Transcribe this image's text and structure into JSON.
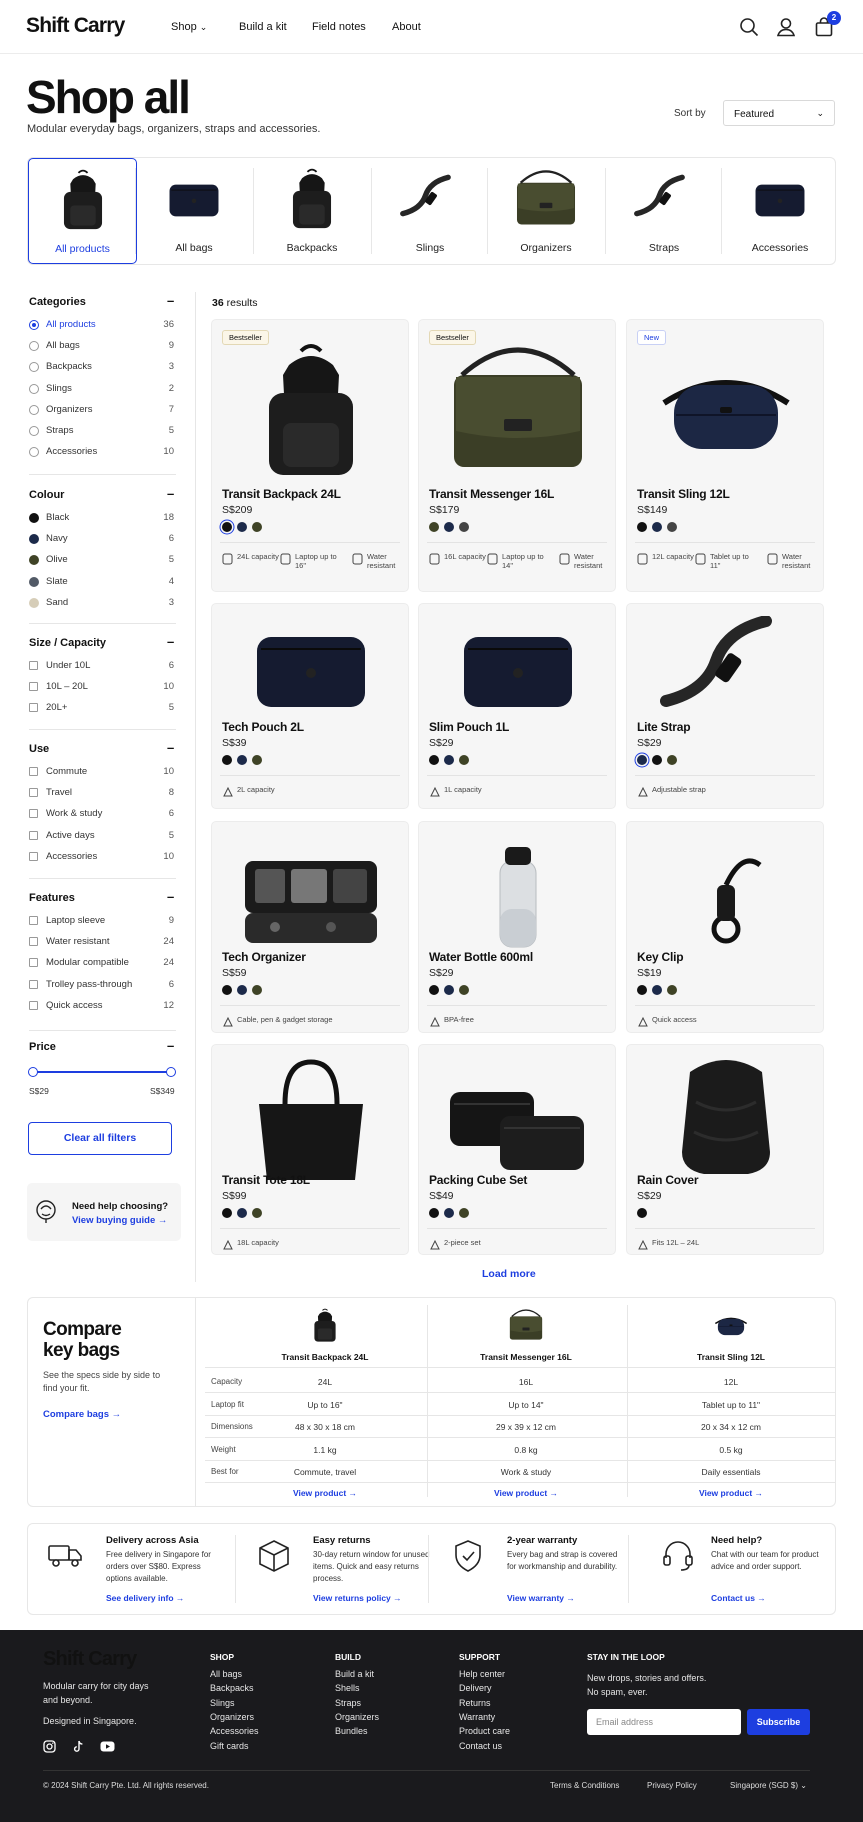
{
  "header": {
    "logo": "Shift Carry",
    "nav": [
      "Shop",
      "Build a kit",
      "Field notes",
      "About"
    ],
    "cart_count": "2"
  },
  "page": {
    "title": "Shop all",
    "subtitle": "Modular everyday bags, organizers, straps and accessories.",
    "sort_label": "Sort by",
    "sort_value": "Featured"
  },
  "categories_strip": [
    "All products",
    "All bags",
    "Backpacks",
    "Slings",
    "Organizers",
    "Straps",
    "Accessories"
  ],
  "filters": {
    "categories": {
      "title": "Categories",
      "items": [
        {
          "label": "All products",
          "count": "36",
          "selected": true
        },
        {
          "label": "All bags",
          "count": "9"
        },
        {
          "label": "Backpacks",
          "count": "3"
        },
        {
          "label": "Slings",
          "count": "2"
        },
        {
          "label": "Organizers",
          "count": "7"
        },
        {
          "label": "Straps",
          "count": "5"
        },
        {
          "label": "Accessories",
          "count": "10"
        }
      ]
    },
    "colour": {
      "title": "Colour",
      "items": [
        {
          "label": "Black",
          "count": "18",
          "color": "#111111"
        },
        {
          "label": "Navy",
          "count": "6",
          "color": "#1c2a4a"
        },
        {
          "label": "Olive",
          "count": "5",
          "color": "#3f4326"
        },
        {
          "label": "Slate",
          "count": "4",
          "color": "#525a66"
        },
        {
          "label": "Sand",
          "count": "3",
          "color": "#d6cdb8"
        }
      ]
    },
    "size": {
      "title": "Size / Capacity",
      "items": [
        {
          "label": "Under 10L",
          "count": "6"
        },
        {
          "label": "10L – 20L",
          "count": "10"
        },
        {
          "label": "20L+",
          "count": "5"
        }
      ]
    },
    "use": {
      "title": "Use",
      "items": [
        {
          "label": "Commute",
          "count": "10"
        },
        {
          "label": "Travel",
          "count": "8"
        },
        {
          "label": "Work & study",
          "count": "6"
        },
        {
          "label": "Active days",
          "count": "5"
        },
        {
          "label": "Accessories",
          "count": "10"
        }
      ]
    },
    "features": {
      "title": "Features",
      "items": [
        {
          "label": "Laptop sleeve",
          "count": "9"
        },
        {
          "label": "Water resistant",
          "count": "24"
        },
        {
          "label": "Modular compatible",
          "count": "24"
        },
        {
          "label": "Trolley pass-through",
          "count": "6"
        },
        {
          "label": "Quick access",
          "count": "12"
        }
      ]
    },
    "price": {
      "title": "Price",
      "min": "S$29",
      "max": "S$349",
      "low_fraction": 0.0,
      "high_fraction": 1.0
    },
    "clear_label": "Clear all filters",
    "help_title": "Need help choosing?",
    "help_link": "View buying guide →"
  },
  "results": {
    "count": "36",
    "label": "results"
  },
  "products": [
    {
      "name": "Transit Backpack 24L",
      "price": "S$209",
      "tag": "Bestseller",
      "swatches": [
        "#111111",
        "#1c2a4a",
        "#3f4326"
      ],
      "ring": 0,
      "features": [
        "24L capacity",
        "Laptop up to 16\"",
        "Water resistant"
      ],
      "icon": "backpack-icon"
    },
    {
      "name": "Transit Messenger 16L",
      "price": "S$179",
      "tag": "Bestseller",
      "swatches": [
        "#3f4326",
        "#1c2a4a",
        "#444444"
      ],
      "ring": -1,
      "features": [
        "16L capacity",
        "Laptop up to 14\"",
        "Water resistant"
      ],
      "icon": "messenger-bag-icon"
    },
    {
      "name": "Transit Sling 12L",
      "price": "S$149",
      "tag": "New",
      "swatches": [
        "#111111",
        "#1c2a4a",
        "#444444"
      ],
      "ring": -1,
      "features": [
        "12L capacity",
        "Tablet up to 11\"",
        "Water resistant"
      ],
      "icon": "sling-bag-icon"
    },
    {
      "name": "Tech Pouch 2L",
      "price": "S$39",
      "swatches": [
        "#111111",
        "#1c2a4a",
        "#3f4326"
      ],
      "ring": -1,
      "features": [
        "2L capacity"
      ],
      "icon": "pouch-icon"
    },
    {
      "name": "Slim Pouch 1L",
      "price": "S$29",
      "swatches": [
        "#111111",
        "#1c2a4a",
        "#3f4326"
      ],
      "ring": -1,
      "features": [
        "1L capacity"
      ],
      "icon": "pouch-icon"
    },
    {
      "name": "Lite Strap",
      "price": "S$29",
      "swatches": [
        "#1c2a4a",
        "#111111",
        "#3f4326"
      ],
      "ring": 0,
      "features": [
        "Adjustable strap"
      ],
      "icon": "strap-icon"
    },
    {
      "name": "Tech Organizer",
      "price": "S$59",
      "swatches": [
        "#111111",
        "#1c2a4a",
        "#3f4326"
      ],
      "ring": -1,
      "features": [
        "Cable, pen & gadget storage"
      ],
      "icon": "organizer-icon"
    },
    {
      "name": "Water Bottle 600ml",
      "price": "S$29",
      "swatches": [
        "#111111",
        "#1c2a4a",
        "#3f4326"
      ],
      "ring": -1,
      "features": [
        "BPA-free"
      ],
      "icon": "bottle-icon"
    },
    {
      "name": "Key Clip",
      "price": "S$19",
      "swatches": [
        "#111111",
        "#1c2a4a",
        "#3f4326"
      ],
      "ring": -1,
      "features": [
        "Quick access"
      ],
      "icon": "key-clip-icon"
    },
    {
      "name": "Transit Tote 18L",
      "price": "S$99",
      "swatches": [
        "#111111",
        "#1c2a4a",
        "#3f4326"
      ],
      "ring": -1,
      "features": [
        "18L capacity"
      ],
      "icon": "tote-icon"
    },
    {
      "name": "Packing Cube Set",
      "price": "S$49",
      "swatches": [
        "#111111",
        "#1c2a4a",
        "#3f4326"
      ],
      "ring": -1,
      "features": [
        "2-piece set"
      ],
      "icon": "packing-cube-icon"
    },
    {
      "name": "Rain Cover",
      "price": "S$29",
      "swatches": [
        "#111111"
      ],
      "ring": -1,
      "features": [
        "Fits 12L – 24L"
      ],
      "icon": "rain-cover-icon"
    }
  ],
  "load_more": "Load more",
  "compare": {
    "title_1": "Compare",
    "title_2": "key bags",
    "description": "See the specs side by side to find your fit.",
    "link": "Compare bags →",
    "columns": [
      "Transit Backpack 24L",
      "Transit Messenger 16L",
      "Transit Sling 12L"
    ],
    "rows": [
      {
        "label": "Capacity",
        "values": [
          "24L",
          "16L",
          "12L"
        ]
      },
      {
        "label": "Laptop fit",
        "values": [
          "Up to 16\"",
          "Up to 14\"",
          "Tablet up to 11\""
        ]
      },
      {
        "label": "Dimensions",
        "values": [
          "48 x 30 x 18 cm",
          "29 x 39 x 12 cm",
          "20 x 34 x 12 cm"
        ]
      },
      {
        "label": "Weight",
        "values": [
          "1.1 kg",
          "0.8 kg",
          "0.5 kg"
        ]
      },
      {
        "label": "Best for",
        "values": [
          "Commute, travel",
          "Work & study",
          "Daily essentials"
        ]
      }
    ],
    "view_link": "View product →"
  },
  "services": [
    {
      "title": "Delivery across Asia",
      "desc": "Free delivery in Singapore for orders over S$80. Express options available.",
      "link": "See delivery info →",
      "icon": "truck-icon"
    },
    {
      "title": "Easy returns",
      "desc": "30-day return window for unused items. Quick and easy returns process.",
      "link": "View returns policy →",
      "icon": "box-icon"
    },
    {
      "title": "2-year warranty",
      "desc": "Every bag and strap is covered for workmanship and durability.",
      "link": "View warranty →",
      "icon": "shield-icon"
    },
    {
      "title": "Need help?",
      "desc": "Chat with our team for product advice and order support.",
      "link": "Contact us →",
      "icon": "headset-icon"
    }
  ],
  "footer": {
    "logo": "Shift Carry",
    "tagline": "Modular carry for city days and beyond.",
    "designed": "Designed in Singapore.",
    "columns": [
      {
        "title": "SHOP",
        "links": [
          "All bags",
          "Backpacks",
          "Slings",
          "Organizers",
          "Accessories",
          "Gift cards"
        ]
      },
      {
        "title": "BUILD",
        "links": [
          "Build a kit",
          "Shells",
          "Straps",
          "Organizers",
          "Bundles"
        ]
      },
      {
        "title": "SUPPORT",
        "links": [
          "Help center",
          "Delivery",
          "Returns",
          "Warranty",
          "Product care",
          "Contact us"
        ]
      }
    ],
    "newsletter_title": "STAY IN THE LOOP",
    "newsletter_text": "New drops, stories and offers. No spam, ever.",
    "email_placeholder": "Email address",
    "subscribe": "Subscribe",
    "copyright": "© 2024 Shift Carry Pte. Ltd. All rights reserved.",
    "terms": "Terms & Conditions",
    "privacy": "Privacy Policy",
    "region": "Singapore (SGD $)"
  }
}
